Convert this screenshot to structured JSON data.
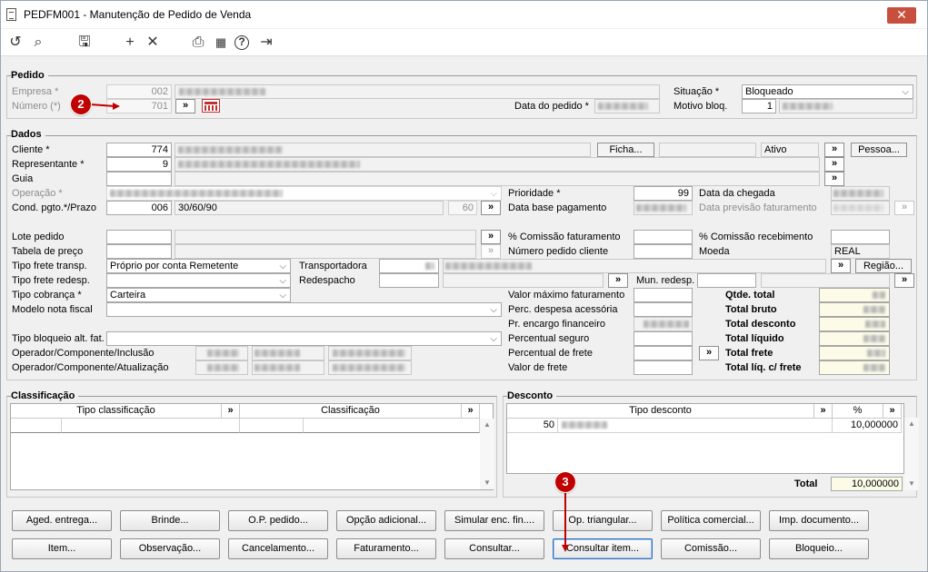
{
  "window": {
    "title": "PEDFM001 - Manutenção de Pedido de Venda",
    "close_label": "✕"
  },
  "toolbar": {
    "undo": "↺",
    "search": "⌕",
    "save": "🖫",
    "add": "+",
    "remove": "✕",
    "print": "⎙",
    "calendar": "▦",
    "help": "?",
    "exit": "⇥"
  },
  "pedido": {
    "title": "Pedido",
    "empresa_label": "Empresa *",
    "empresa_value": "002",
    "numero_label": "Número (*)",
    "numero_value": "701",
    "data_pedido_label": "Data do pedido *",
    "situacao_label": "Situação *",
    "situacao_value": "Bloqueado",
    "motivo_label": "Motivo bloq.",
    "motivo_value": "1"
  },
  "dados": {
    "title": "Dados",
    "cliente_label": "Cliente *",
    "cliente_value": "774",
    "ficha_button": "Ficha...",
    "status_value": "Ativo",
    "pessoa_button": "Pessoa...",
    "representante_label": "Representante *",
    "representante_value": "9",
    "guia_label": "Guia",
    "operacao_label": "Operação *",
    "cond_label": "Cond. pgto.*/Prazo",
    "cond_value": "006",
    "cond_desc": "30/60/90",
    "prazo_value": "60",
    "prioridade_label": "Prioridade *",
    "prioridade_value": "99",
    "data_base_label": "Data base pagamento",
    "data_chegada_label": "Data da chegada",
    "data_prev_label": "Data previsão faturamento",
    "lote_label": "Lote pedido",
    "tabela_label": "Tabela de preço",
    "com_fat_label": "% Comissão faturamento",
    "num_cliente_label": "Número pedido cliente",
    "com_rec_label": "% Comissão recebimento",
    "moeda_label": "Moeda",
    "moeda_value": "REAL",
    "frete_transp_label": "Tipo frete transp.",
    "frete_transp_value": "Próprio por conta Remetente",
    "transportadora_label": "Transportadora",
    "regiao_button": "Região...",
    "frete_redesp_label": "Tipo frete redesp.",
    "redespacho_label": "Redespacho",
    "mun_redesp_label": "Mun. redesp.",
    "cobranca_label": "Tipo cobrança *",
    "cobranca_value": "Carteira",
    "modelo_label": "Modelo nota fiscal",
    "bloqueio_label": "Tipo bloqueio alt. fat.",
    "op_inclusao_label": "Operador/Componente/Inclusão",
    "op_atualizacao_label": "Operador/Componente/Atualização",
    "valor_max_label": "Valor máximo faturamento",
    "perc_desp_label": "Perc. despesa acessória",
    "pr_encargo_label": "Pr. encargo financeiro",
    "perc_seguro_label": "Percentual seguro",
    "perc_frete_label": "Percentual de frete",
    "valor_frete_label": "Valor de frete",
    "qtde_total_label": "Qtde. total",
    "total_bruto_label": "Total bruto",
    "total_desconto_label": "Total desconto",
    "total_liquido_label": "Total líquido",
    "total_frete_label": "Total frete",
    "total_liq_frete_label": "Total líq. c/ frete"
  },
  "classificacao": {
    "title": "Classificação",
    "col1": "Tipo classificação",
    "col2": "Classificação"
  },
  "desconto": {
    "title": "Desconto",
    "col1": "Tipo desconto",
    "col2": "%",
    "row_code": "50",
    "row_value": "10,000000",
    "total_label": "Total",
    "total_value": "10,000000"
  },
  "actions": {
    "row1": [
      "Aged. entrega...",
      "Brinde...",
      "O.P. pedido...",
      "Opção adicional...",
      "Simular enc. fin....",
      "Op. triangular...",
      "Política comercial...",
      "Imp. documento..."
    ],
    "row2": [
      "Item...",
      "Observação...",
      "Cancelamento...",
      "Faturamento...",
      "Consultar...",
      "Consultar item...",
      "Comissão...",
      "Bloqueio..."
    ]
  },
  "markers": {
    "m2": "2",
    "m3": "3"
  },
  "colors": {
    "marker": "#c00000",
    "focus": "#2f6fb8"
  }
}
